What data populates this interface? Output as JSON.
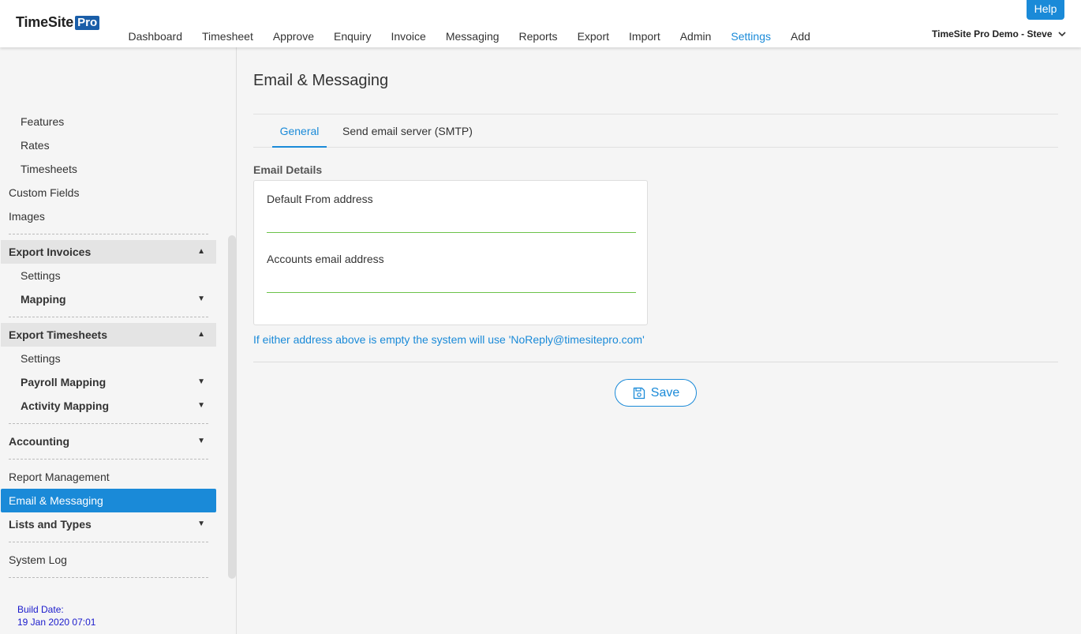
{
  "app": {
    "logo_text": "TimeSite",
    "logo_badge": "Pro"
  },
  "nav": {
    "items": [
      "Dashboard",
      "Timesheet",
      "Approve",
      "Enquiry",
      "Invoice",
      "Messaging",
      "Reports",
      "Export",
      "Import",
      "Admin",
      "Settings",
      "Add"
    ],
    "active": "Settings"
  },
  "header": {
    "help_label": "Help",
    "account_label": "TimeSite Pro Demo - Steve"
  },
  "sidebar": {
    "features": "Features",
    "rates": "Rates",
    "timesheets": "Timesheets",
    "custom_fields": "Custom Fields",
    "images": "Images",
    "export_invoices": "Export Invoices",
    "export_invoices_settings": "Settings",
    "export_invoices_mapping": "Mapping",
    "export_timesheets": "Export Timesheets",
    "export_timesheets_settings": "Settings",
    "payroll_mapping": "Payroll Mapping",
    "activity_mapping": "Activity Mapping",
    "accounting": "Accounting",
    "report_management": "Report Management",
    "email_messaging": "Email & Messaging",
    "lists_and_types": "Lists and Types",
    "system_log": "System Log",
    "build_label": "Build Date:",
    "build_date": "19 Jan 2020 07:01"
  },
  "main": {
    "title": "Email & Messaging",
    "tabs": [
      "General",
      "Send email server (SMTP)"
    ],
    "active_tab": "General",
    "section_label": "Email Details",
    "default_from_label": "Default From address",
    "default_from_value": "",
    "accounts_email_label": "Accounts email address",
    "accounts_email_value": "",
    "hint": "If either address above is empty the system will use 'NoReply@timesitepro.com'",
    "save_label": "Save"
  },
  "colors": {
    "accent": "#1a8ad8",
    "input_underline": "#6cc24a",
    "logo_badge": "#1a5ea8"
  }
}
